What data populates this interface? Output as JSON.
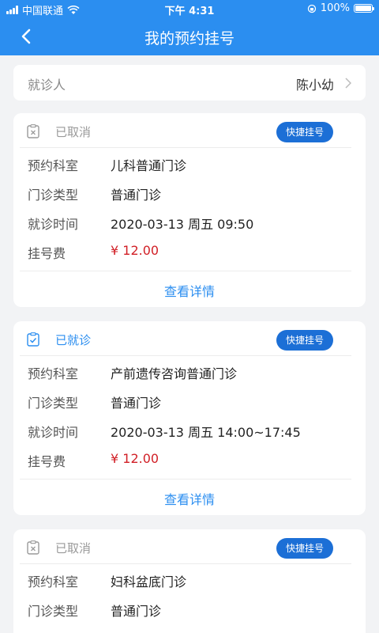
{
  "status_bar": {
    "carrier": "中国联通",
    "time": "下午 4:31",
    "battery": "100%"
  },
  "nav": {
    "title": "我的预约挂号"
  },
  "patient": {
    "label": "就诊人",
    "name": "陈小幼"
  },
  "labels": {
    "dept": "预约科室",
    "type": "门诊类型",
    "time": "就诊时间",
    "fee": "挂号费"
  },
  "quick_button": "快捷挂号",
  "detail_link": "查看详情",
  "colors": {
    "primary": "#2b8ef0",
    "button": "#1c6fd6",
    "price": "#d11f26",
    "cancelled": "#9a9a9a",
    "visited": "#2b8ef0"
  },
  "appointments": [
    {
      "status": "已取消",
      "status_icon": "cancelled-clipboard-icon",
      "dept": "儿科普通门诊",
      "type": "普通门诊",
      "time": "2020-03-13 周五 09:50",
      "fee": "¥ 12.00"
    },
    {
      "status": "已就诊",
      "status_icon": "checked-clipboard-icon",
      "dept": "产前遗传咨询普通门诊",
      "type": "普通门诊",
      "time": "2020-03-13 周五 14:00~17:45",
      "fee": "¥ 12.00"
    },
    {
      "status": "已取消",
      "status_icon": "cancelled-clipboard-icon",
      "dept": "妇科盆底门诊",
      "type": "普通门诊"
    }
  ]
}
